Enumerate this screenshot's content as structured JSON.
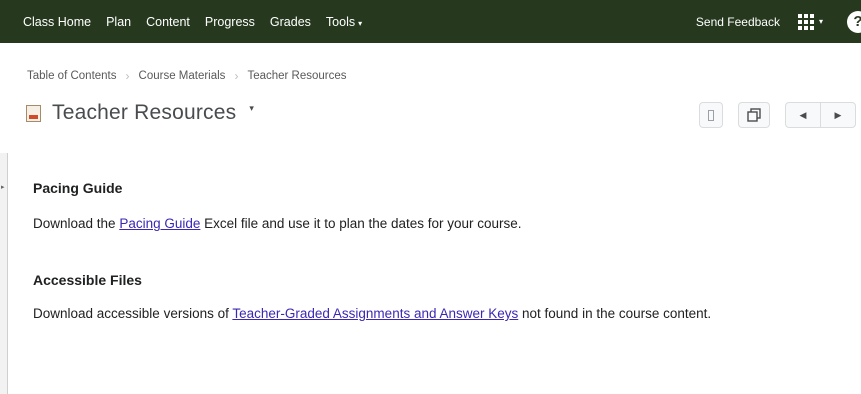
{
  "navbar": {
    "links": [
      "Class Home",
      "Plan",
      "Content",
      "Progress",
      "Grades",
      "Tools"
    ],
    "tools_caret": "▾",
    "send_feedback": "Send Feedback",
    "grid_caret": "▾",
    "help": "?"
  },
  "breadcrumb": {
    "items": [
      "Table of Contents",
      "Course Materials",
      "Teacher Resources"
    ],
    "separator": "›"
  },
  "title": {
    "text": "Teacher Resources",
    "caret": "▾"
  },
  "toolbar": {
    "prev": "◀",
    "next": "▶"
  },
  "sections": {
    "pacing": {
      "heading": "Pacing Guide",
      "text_before": "Download the ",
      "link": "Pacing Guide",
      "text_after": " Excel file and use it to plan the dates for your course."
    },
    "accessible": {
      "heading": "Accessible Files",
      "text_before": "Download accessible versions of ",
      "link": "Teacher-Graded Assignments and Answer Keys",
      "text_after": " not found in the course content."
    }
  },
  "colors": {
    "navbar_bg": "#26391f",
    "link": "#3a28b5"
  }
}
